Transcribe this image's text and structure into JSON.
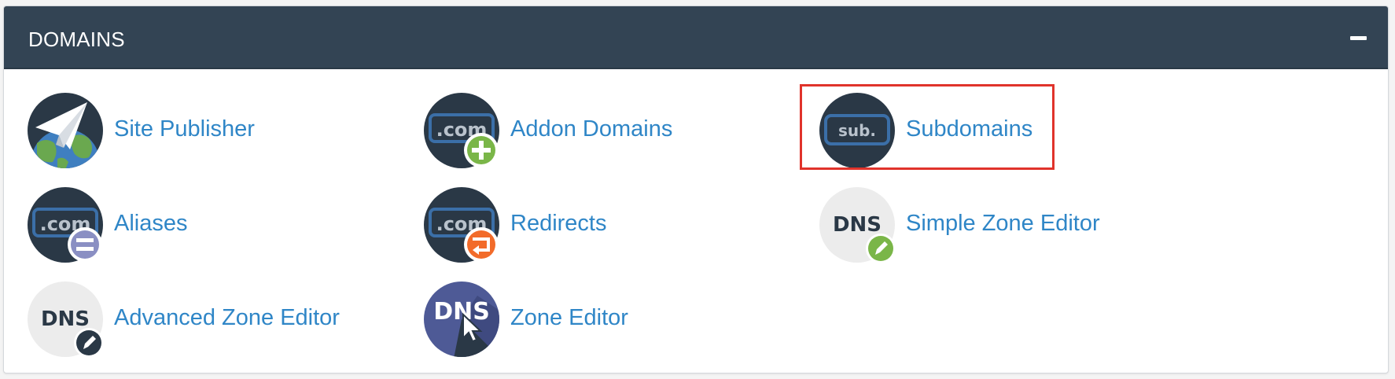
{
  "panel": {
    "title": "DOMAINS",
    "collapse_symbol": "minus-icon"
  },
  "colors": {
    "header_bg": "#334454",
    "link": "#2f86c7",
    "icon_dark": "#2a3846",
    "icon_light": "#ececec",
    "highlight": "#e0332b",
    "plus_green": "#7ab648",
    "redirect_orange": "#f26b2a",
    "alias_purple": "#8a8fc3",
    "zone_purple": "#4e5a96"
  },
  "items": [
    {
      "label": "Site Publisher",
      "icon": "paper-plane-globe-icon"
    },
    {
      "label": "Addon Domains",
      "icon": "dotcom-plus-icon",
      "icon_text": ".com"
    },
    {
      "label": "Subdomains",
      "icon": "sub-icon",
      "icon_text": "sub.",
      "highlighted": true
    },
    {
      "label": "Aliases",
      "icon": "dotcom-equals-icon",
      "icon_text": ".com"
    },
    {
      "label": "Redirects",
      "icon": "dotcom-redirect-icon",
      "icon_text": ".com"
    },
    {
      "label": "Simple Zone Editor",
      "icon": "dns-pencil-green-icon",
      "icon_text": "DNS"
    },
    {
      "label": "Advanced Zone Editor",
      "icon": "dns-pencil-dark-icon",
      "icon_text": "DNS"
    },
    {
      "label": "Zone Editor",
      "icon": "dns-cursor-icon",
      "icon_text": "DNS"
    }
  ]
}
